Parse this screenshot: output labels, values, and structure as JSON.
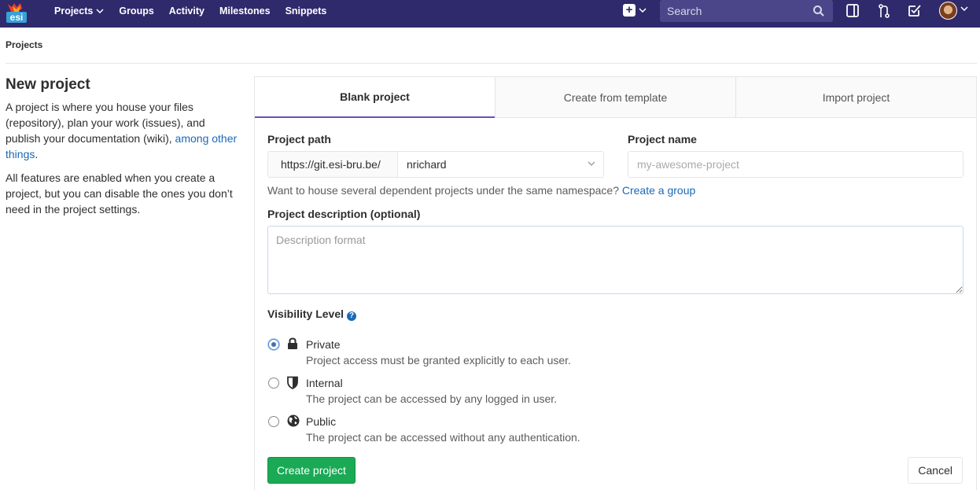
{
  "navbar": {
    "logo_text": "esi",
    "links": [
      {
        "label": "Projects",
        "has_dropdown": true
      },
      {
        "label": "Groups"
      },
      {
        "label": "Activity"
      },
      {
        "label": "Milestones"
      },
      {
        "label": "Snippets"
      }
    ],
    "search_placeholder": "Search",
    "icons": [
      "plus-square-icon",
      "search-icon",
      "sidebar-toggle-icon",
      "merge-request-icon",
      "todo-check-icon",
      "avatar",
      "chevron-down-icon"
    ],
    "color": "#2f2a6b"
  },
  "breadcrumb": {
    "current": "Projects"
  },
  "intro": {
    "title": "New project",
    "paragraph1_text": "A project is where you house your files (repository), plan your work (issues), and publish your documentation (wiki), ",
    "paragraph1_link": "among other things",
    "paragraph1_end": ".",
    "paragraph2": "All features are enabled when you create a project, but you can disable the ones you don’t need in the project settings."
  },
  "tabs": [
    {
      "label": "Blank project",
      "active": true
    },
    {
      "label": "Create from template",
      "active": false
    },
    {
      "label": "Import project",
      "active": false
    }
  ],
  "form": {
    "project_path_label": "Project path",
    "path_prefix": "https://git.esi-bru.be/",
    "namespace_value": "nrichard",
    "project_name_label": "Project name",
    "project_name_placeholder": "my-awesome-project",
    "namespace_help_text": "Want to house several dependent projects under the same namespace?",
    "namespace_help_link": "Create a group",
    "description_label": "Project description (optional)",
    "description_placeholder": "Description format",
    "visibility_label": "Visibility Level",
    "visibility_options": [
      {
        "title": "Private",
        "description": "Project access must be granted explicitly to each user.",
        "icon": "lock-icon",
        "checked": true
      },
      {
        "title": "Internal",
        "description": "The project can be accessed by any logged in user.",
        "icon": "shield-icon",
        "checked": false
      },
      {
        "title": "Public",
        "description": "The project can be accessed without any authentication.",
        "icon": "globe-icon",
        "checked": false
      }
    ],
    "create_button": "Create project",
    "cancel_button": "Cancel",
    "create_button_color": "#1aaa55"
  }
}
